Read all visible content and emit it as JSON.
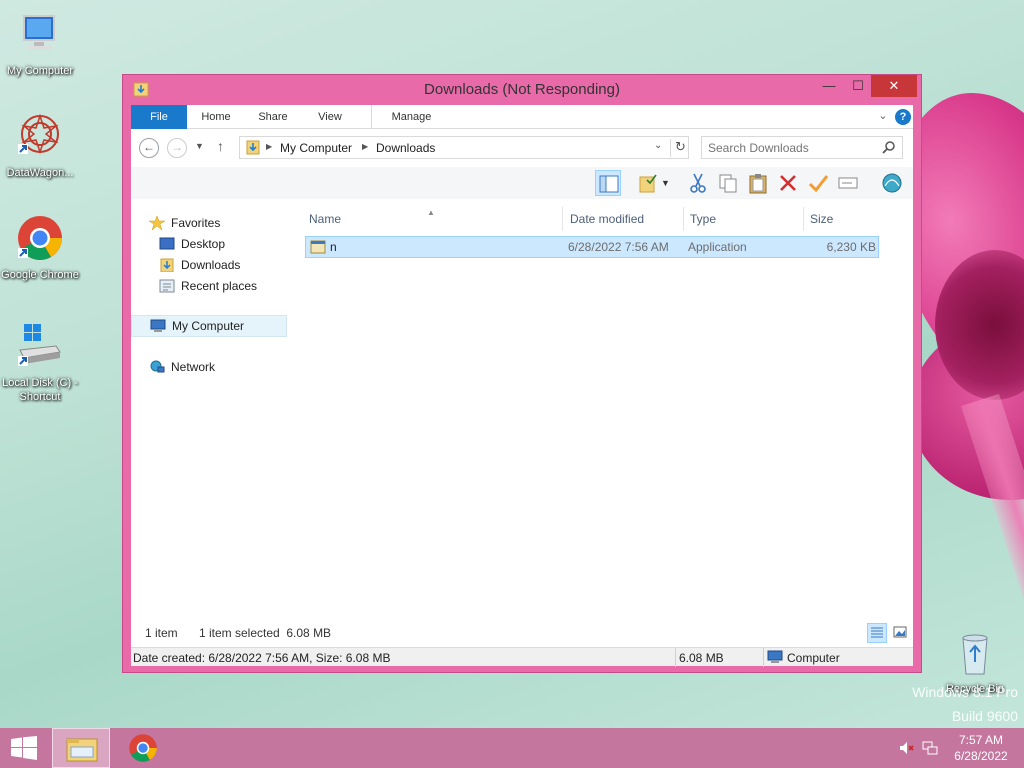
{
  "desktop": {
    "icons": [
      {
        "label": "My Computer"
      },
      {
        "label": "DataWagon..."
      },
      {
        "label": "Google Chrome"
      },
      {
        "label": "Local Disk (C) - Shortcut"
      },
      {
        "label": "Recycle Bin"
      }
    ],
    "watermark_line1": "Windows 8.1 Pro",
    "watermark_line2": "Build 9600"
  },
  "window": {
    "title": "Downloads (Not Responding)",
    "minimize_glyph": "—",
    "maximize_glyph": "☐",
    "close_glyph": "✕"
  },
  "ribbon": {
    "tabs": [
      {
        "label": "File"
      },
      {
        "label": "Home"
      },
      {
        "label": "Share"
      },
      {
        "label": "View"
      },
      {
        "label": "Manage"
      }
    ],
    "help_glyph": "?"
  },
  "address": {
    "breadcrumbs": [
      "My Computer",
      "Downloads"
    ]
  },
  "search": {
    "placeholder": "Search Downloads"
  },
  "navpane": {
    "items": [
      {
        "label": "Favorites"
      },
      {
        "label": "Desktop"
      },
      {
        "label": "Downloads"
      },
      {
        "label": "Recent places"
      },
      {
        "label": "My Computer"
      },
      {
        "label": "Network"
      }
    ]
  },
  "filelist": {
    "columns": [
      "Name",
      "Date modified",
      "Type",
      "Size"
    ],
    "rows": [
      {
        "name": "n",
        "date": "6/28/2022 7:56 AM",
        "type": "Application",
        "size": "6,230 KB"
      }
    ]
  },
  "status": {
    "item_count": "1 item",
    "selection": "1 item selected  6.08 MB",
    "details": "Date created: 6/28/2022 7:56 AM, Size: 6.08 MB",
    "size": "6.08 MB",
    "location": "Computer"
  },
  "taskbar": {
    "time": "7:57 AM",
    "date": "6/28/2022"
  },
  "colors": {
    "window_frame": "#e86aa9",
    "accent": "#1979ca",
    "selection": "#cce8ff",
    "taskbar": "#c5769f"
  }
}
